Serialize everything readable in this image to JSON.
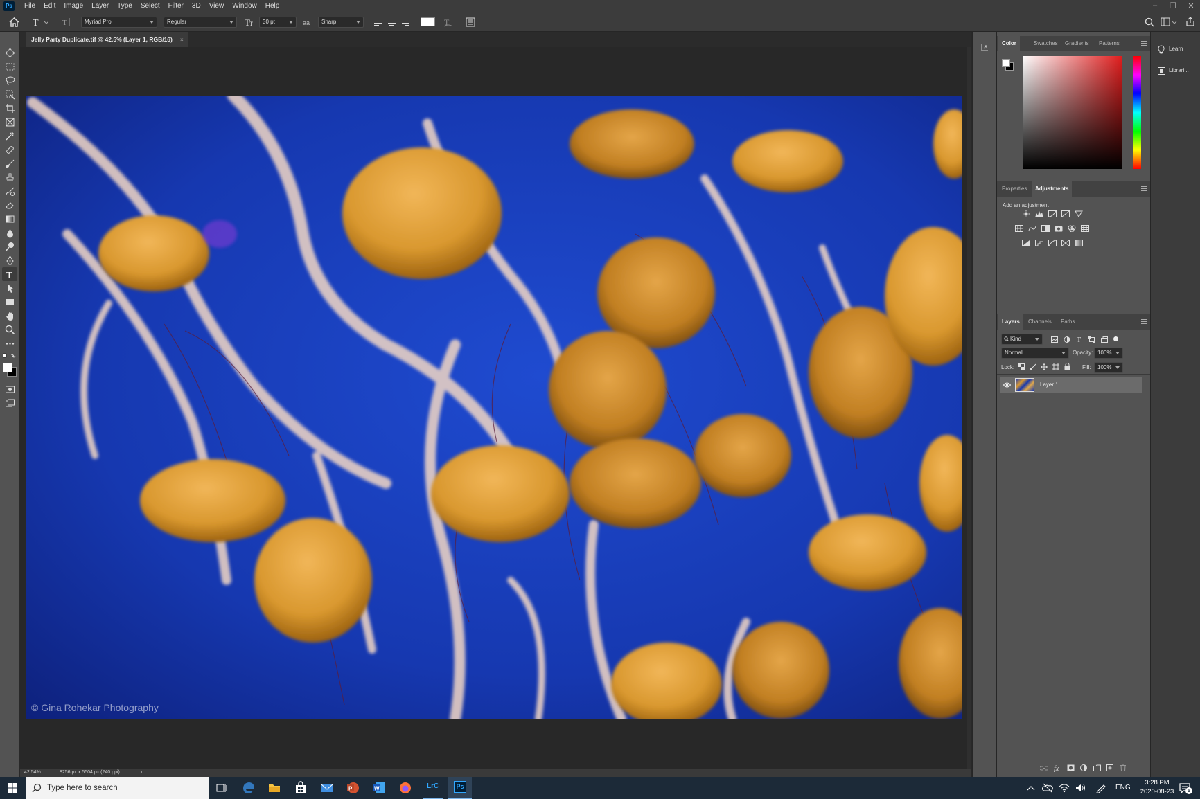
{
  "app": {
    "logo": "Ps",
    "menu": [
      "File",
      "Edit",
      "Image",
      "Layer",
      "Type",
      "Select",
      "Filter",
      "3D",
      "View",
      "Window",
      "Help"
    ]
  },
  "options_bar": {
    "font_family": "Myriad Pro",
    "font_style": "Regular",
    "font_size": "30 pt",
    "antialias": "Sharp",
    "text_color": "#ffffff"
  },
  "document": {
    "tab_title": "Jelly Party Duplicate.tif @ 42.5% (Layer 1, RGB/16)",
    "watermark": "© Gina Rohekar Photography"
  },
  "status": {
    "zoom": "42.54%",
    "doc_size": "8256 px x 5504 px (240 ppi)",
    "arrow": "›"
  },
  "color_panel": {
    "tabs": [
      "Color",
      "Swatches",
      "Gradients",
      "Patterns"
    ],
    "active_tab": "Color",
    "picker_hue": "#e01e1e"
  },
  "adjust_panel": {
    "tabs": [
      "Properties",
      "Adjustments"
    ],
    "active_tab": "Adjustments",
    "add_label": "Add an adjustment"
  },
  "layers_panel": {
    "tabs": [
      "Layers",
      "Channels",
      "Paths"
    ],
    "active_tab": "Layers",
    "filter_kind": "Kind",
    "blend_mode": "Normal",
    "opacity_label": "Opacity:",
    "opacity_value": "100%",
    "lock_label": "Lock:",
    "fill_label": "Fill:",
    "fill_value": "100%",
    "layers": [
      {
        "name": "Layer 1"
      }
    ]
  },
  "right_dock": {
    "learn": "Learn",
    "libraries": "Librari..."
  },
  "taskbar": {
    "search_placeholder": "Type here to search",
    "lang": "ENG",
    "time": "3:28 PM",
    "date": "2020-08-23",
    "lrc": "LrC",
    "ps": "Ps",
    "notif_count": "5"
  }
}
